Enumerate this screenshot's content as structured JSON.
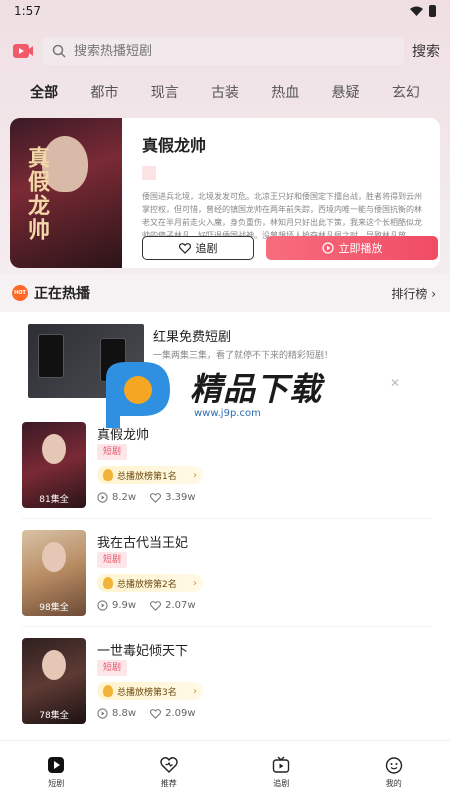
{
  "status_bar": {
    "time": "1:57"
  },
  "search": {
    "placeholder": "搜索热播短剧",
    "button_label": "搜索"
  },
  "category_tabs": [
    "全部",
    "都市",
    "现言",
    "古装",
    "热血",
    "悬疑",
    "玄幻"
  ],
  "featured": {
    "poster_title": "真假龙帅",
    "title": "真假龙帅",
    "description": "倭国进兵北境，北境发发可危。北凉王只好和倭国定下擂台战，胜者将得到云州掌控权，但可惜，曾经的镇国龙帅在两年前失踪，西境内唯一能与倭国抗衡的林老又在半月前走火入魔，身负重伤，林知月只好出此下策，我来这个长相酷似龙帅的傻子林凡，好吓退倭国战神。没曾想坏人抢夺林凡佩之时，导致林凡放...",
    "follow_label": "追剧",
    "play_label": "立即播放"
  },
  "hot": {
    "badge": "HOT",
    "title": "正在热播",
    "rank_link": "排行榜"
  },
  "ad": {
    "title": "红果免费短剧",
    "subtitle": "一集两集三集，看了就停不下来的精彩短剧！",
    "close": "✕"
  },
  "watermark": {
    "text": "精品下载",
    "url": "www.j9p.com"
  },
  "dramas": [
    {
      "title": "真假龙帅",
      "poster_title": "真假龙帅",
      "episodes": "81集全",
      "tag": "短剧",
      "rank": "总播放榜第1名",
      "plays": "8.2w",
      "likes": "3.39w"
    },
    {
      "title": "我在古代当王妃",
      "poster_title": "",
      "episodes": "98集全",
      "tag": "短剧",
      "rank": "总播放榜第2名",
      "plays": "9.9w",
      "likes": "2.07w"
    },
    {
      "title": "一世毒妃倾天下",
      "poster_title": "一世毒妃",
      "episodes": "78集全",
      "tag": "短剧",
      "rank": "总播放榜第3名",
      "plays": "8.8w",
      "likes": "2.09w"
    }
  ],
  "bottom_nav": [
    {
      "label": "短剧",
      "icon": "play-square-icon"
    },
    {
      "label": "推荐",
      "icon": "heart-icon"
    },
    {
      "label": "追剧",
      "icon": "tv-icon"
    },
    {
      "label": "我的",
      "icon": "smile-face-icon"
    }
  ],
  "colors": {
    "accent": "#f04c64",
    "brand_icon": "#f25a6a"
  }
}
